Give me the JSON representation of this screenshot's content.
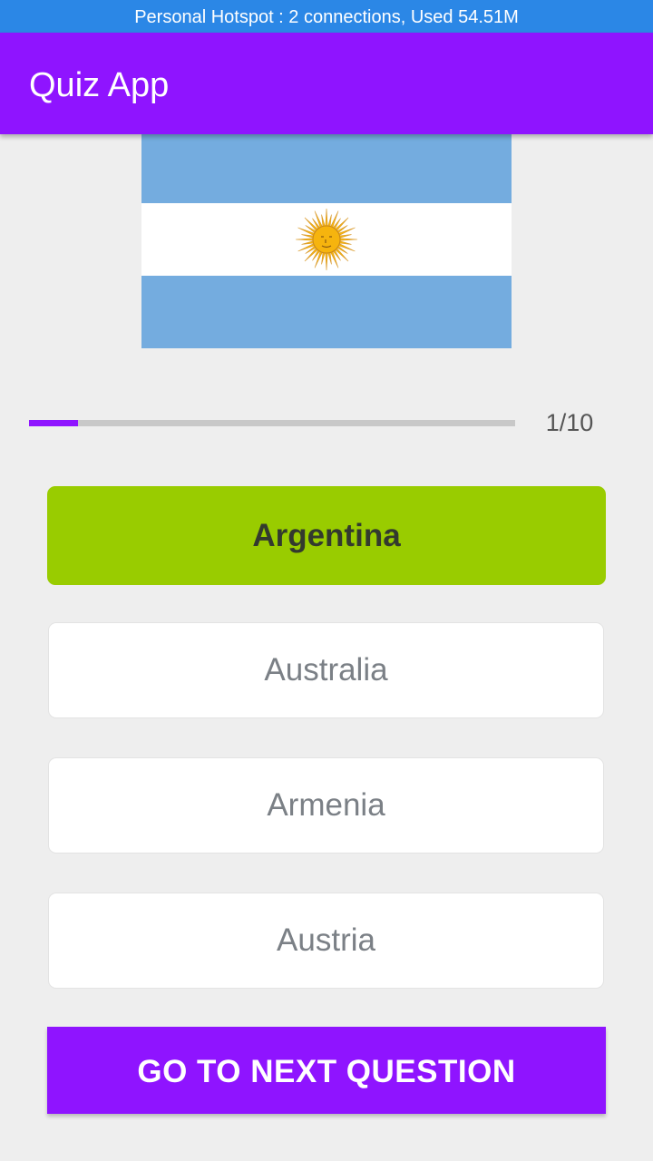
{
  "status_bar": {
    "text": "Personal Hotspot : 2 connections, Used 54.51M",
    "color": "#2b87e6"
  },
  "app_bar": {
    "title": "Quiz App",
    "color": "#8f14ff"
  },
  "question": {
    "flag_icon": "argentina-flag",
    "flag_colors": {
      "blue": "#74acdf",
      "white": "#ffffff",
      "sun": "#f6b40e"
    }
  },
  "progress": {
    "current": 1,
    "total": 10,
    "label": "1/10"
  },
  "options": [
    {
      "label": "Argentina",
      "selected": true
    },
    {
      "label": "Australia",
      "selected": false
    },
    {
      "label": "Armenia",
      "selected": false
    },
    {
      "label": "Austria",
      "selected": false
    }
  ],
  "colors": {
    "accent": "#8f14ff",
    "correct": "#99cc00",
    "background": "#eeeeee"
  },
  "next_button": {
    "label": "GO TO NEXT QUESTION"
  }
}
